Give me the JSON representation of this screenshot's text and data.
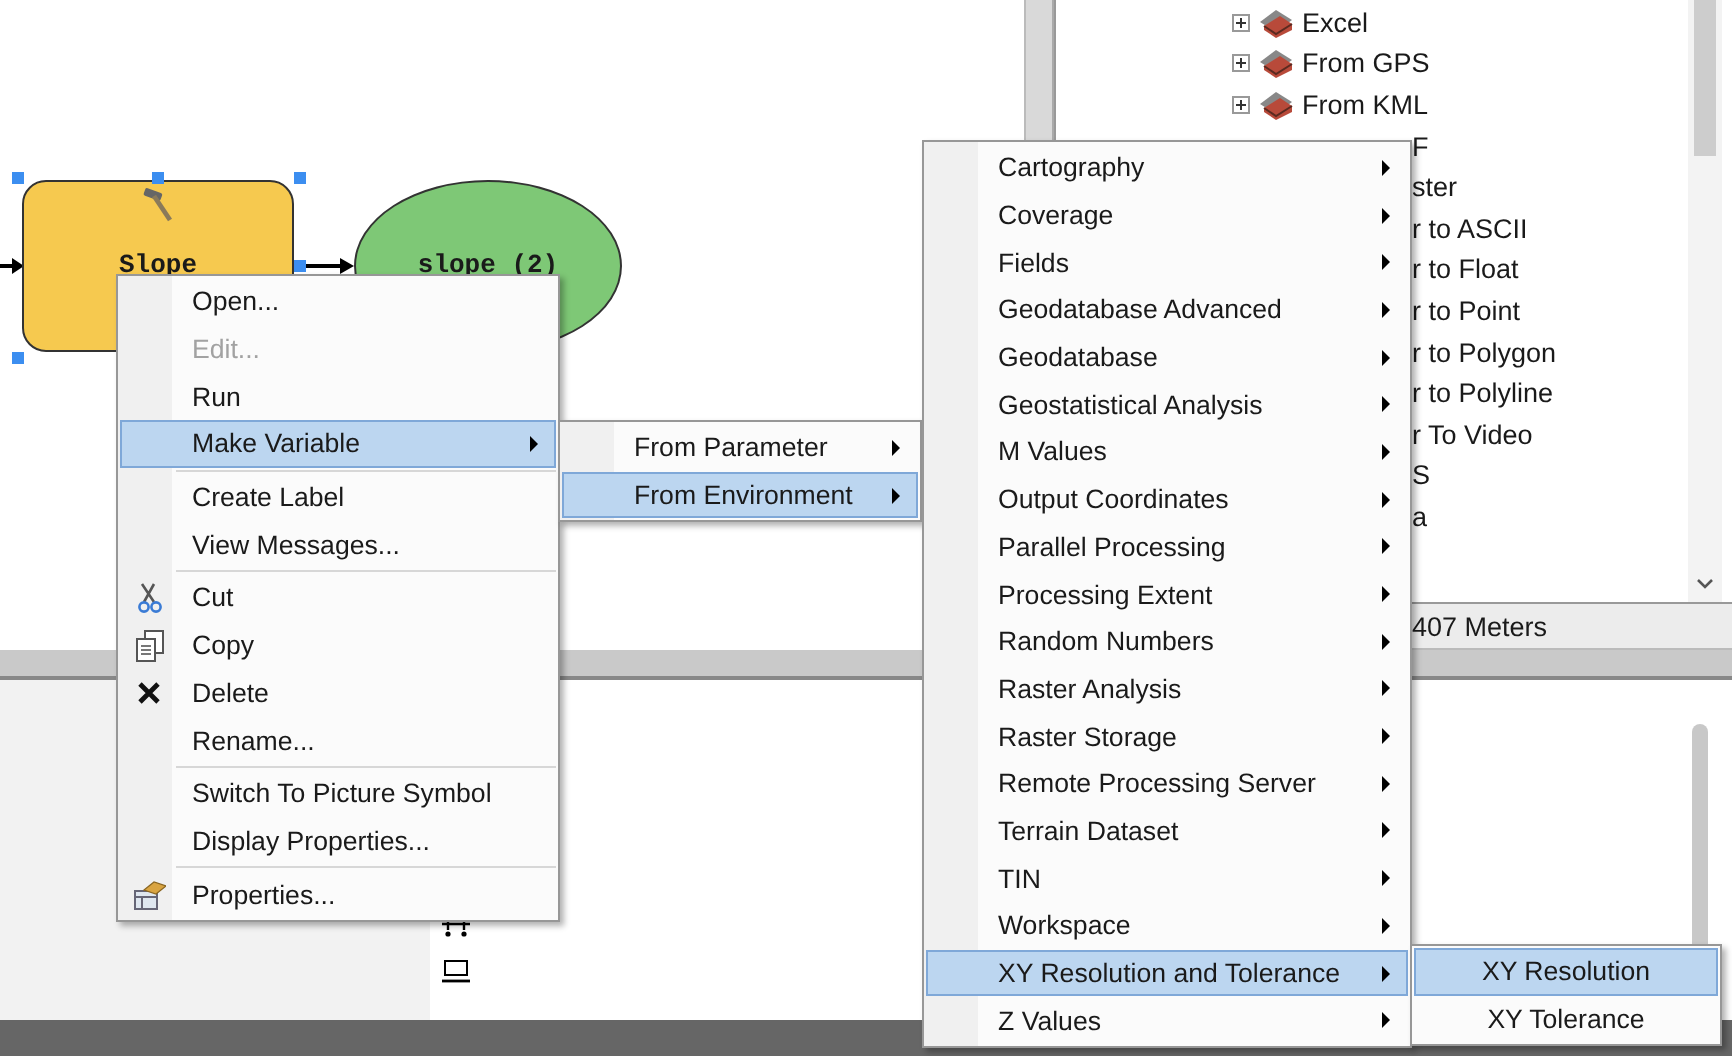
{
  "model_canvas": {
    "nodes": [
      {
        "kind": "tool",
        "label": "Slope",
        "selected": true
      },
      {
        "kind": "data",
        "label": "slope (2)",
        "selected": false
      }
    ]
  },
  "toolbox_tree": {
    "items": [
      {
        "kind": "node",
        "label": "Excel"
      },
      {
        "kind": "node",
        "label": "From GPS"
      },
      {
        "kind": "node",
        "label": "From KML"
      },
      {
        "kind": "fragment",
        "label": "F"
      },
      {
        "kind": "fragment",
        "label": "ster"
      },
      {
        "kind": "fragment",
        "label": "r to ASCII"
      },
      {
        "kind": "fragment",
        "label": "r to Float"
      },
      {
        "kind": "fragment",
        "label": "r to Point"
      },
      {
        "kind": "fragment",
        "label": "r to Polygon"
      },
      {
        "kind": "fragment",
        "label": "r to Polyline"
      },
      {
        "kind": "fragment",
        "label": "r To Video"
      },
      {
        "kind": "fragment",
        "label": "S"
      },
      {
        "kind": "fragment",
        "label": "a"
      }
    ]
  },
  "status_bar": {
    "text": "407 Meters"
  },
  "context_menu": {
    "items": [
      {
        "kind": "item",
        "label": "Open...",
        "disabled": false,
        "selected": false,
        "submenu": false
      },
      {
        "kind": "item",
        "label": "Edit...",
        "disabled": true,
        "selected": false,
        "submenu": false
      },
      {
        "kind": "item",
        "label": "Run",
        "disabled": false,
        "selected": false,
        "submenu": false
      },
      {
        "kind": "item",
        "label": "Make Variable",
        "disabled": false,
        "selected": true,
        "submenu": true
      },
      {
        "kind": "separator"
      },
      {
        "kind": "item",
        "label": "Create Label",
        "disabled": false,
        "selected": false,
        "submenu": false
      },
      {
        "kind": "item",
        "label": "View Messages...",
        "disabled": false,
        "selected": false,
        "submenu": false
      },
      {
        "kind": "separator"
      },
      {
        "kind": "item",
        "label": "Cut",
        "disabled": false,
        "selected": false,
        "submenu": false
      },
      {
        "kind": "item",
        "label": "Copy",
        "disabled": false,
        "selected": false,
        "submenu": false
      },
      {
        "kind": "item",
        "label": "Delete",
        "disabled": false,
        "selected": false,
        "submenu": false
      },
      {
        "kind": "item",
        "label": "Rename...",
        "disabled": false,
        "selected": false,
        "submenu": false
      },
      {
        "kind": "separator"
      },
      {
        "kind": "item",
        "label": "Switch To Picture Symbol",
        "disabled": false,
        "selected": false,
        "submenu": false
      },
      {
        "kind": "item",
        "label": "Display Properties...",
        "disabled": false,
        "selected": false,
        "submenu": false
      },
      {
        "kind": "separator"
      },
      {
        "kind": "item",
        "label": "Properties...",
        "disabled": false,
        "selected": false,
        "submenu": false
      }
    ]
  },
  "make_variable_menu": {
    "items": [
      {
        "kind": "item",
        "label": "From Parameter",
        "disabled": false,
        "selected": false,
        "submenu": true
      },
      {
        "kind": "item",
        "label": "From Environment",
        "disabled": false,
        "selected": true,
        "submenu": true
      }
    ]
  },
  "environment_menu": {
    "items": [
      {
        "kind": "item",
        "label": "Cartography",
        "disabled": false,
        "selected": false,
        "submenu": true
      },
      {
        "kind": "item",
        "label": "Coverage",
        "disabled": false,
        "selected": false,
        "submenu": true
      },
      {
        "kind": "item",
        "label": "Fields",
        "disabled": false,
        "selected": false,
        "submenu": true
      },
      {
        "kind": "item",
        "label": "Geodatabase Advanced",
        "disabled": false,
        "selected": false,
        "submenu": true
      },
      {
        "kind": "item",
        "label": "Geodatabase",
        "disabled": false,
        "selected": false,
        "submenu": true
      },
      {
        "kind": "item",
        "label": "Geostatistical Analysis",
        "disabled": false,
        "selected": false,
        "submenu": true
      },
      {
        "kind": "item",
        "label": "M Values",
        "disabled": false,
        "selected": false,
        "submenu": true
      },
      {
        "kind": "item",
        "label": "Output Coordinates",
        "disabled": false,
        "selected": false,
        "submenu": true
      },
      {
        "kind": "item",
        "label": "Parallel Processing",
        "disabled": false,
        "selected": false,
        "submenu": true
      },
      {
        "kind": "item",
        "label": "Processing Extent",
        "disabled": false,
        "selected": false,
        "submenu": true
      },
      {
        "kind": "item",
        "label": "Random Numbers",
        "disabled": false,
        "selected": false,
        "submenu": true
      },
      {
        "kind": "item",
        "label": "Raster Analysis",
        "disabled": false,
        "selected": false,
        "submenu": true
      },
      {
        "kind": "item",
        "label": "Raster Storage",
        "disabled": false,
        "selected": false,
        "submenu": true
      },
      {
        "kind": "item",
        "label": "Remote Processing Server",
        "disabled": false,
        "selected": false,
        "submenu": true
      },
      {
        "kind": "item",
        "label": "Terrain Dataset",
        "disabled": false,
        "selected": false,
        "submenu": true
      },
      {
        "kind": "item",
        "label": "TIN",
        "disabled": false,
        "selected": false,
        "submenu": true
      },
      {
        "kind": "item",
        "label": "Workspace",
        "disabled": false,
        "selected": false,
        "submenu": true
      },
      {
        "kind": "item",
        "label": "XY Resolution and Tolerance",
        "disabled": false,
        "selected": true,
        "submenu": true
      },
      {
        "kind": "item",
        "label": "Z Values",
        "disabled": false,
        "selected": false,
        "submenu": true
      }
    ]
  },
  "xy_menu": {
    "items": [
      {
        "kind": "item",
        "label": "XY Resolution",
        "disabled": false,
        "selected": true,
        "submenu": false
      },
      {
        "kind": "item",
        "label": "XY Tolerance",
        "disabled": false,
        "selected": false,
        "submenu": false
      }
    ]
  }
}
